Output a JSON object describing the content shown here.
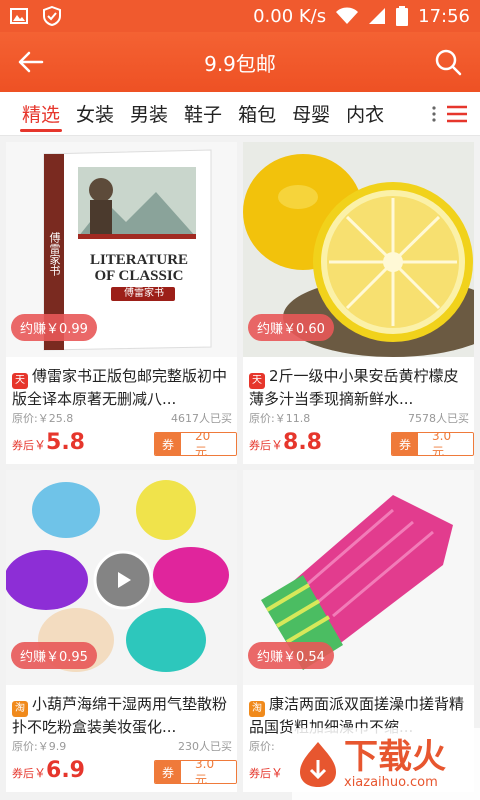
{
  "status": {
    "speed": "0.00 K/s",
    "time": "17:56"
  },
  "appbar": {
    "title": "9.9包邮"
  },
  "tabs": [
    "精选",
    "女装",
    "男装",
    "鞋子",
    "箱包",
    "母婴",
    "内衣"
  ],
  "products": [
    {
      "title": "傅雷家书正版包邮完整版初中版全译本原著无删减八...",
      "earn": "约赚￥0.99",
      "orig": "原价:￥25.8",
      "sold": "4617人已买",
      "after_label": "券后",
      "sym": "￥",
      "price": "5.8",
      "coupon_label": "券",
      "coupon": "20元",
      "source": "tmall",
      "cover": {
        "series": "LITERATURE OF CLASSIC",
        "name": "傅雷家书",
        "spine": "傅雷家书"
      }
    },
    {
      "title": "2斤一级中小果安岳黄柠檬皮薄多汁当季现摘新鲜水...",
      "earn": "约赚￥0.60",
      "orig": "原价:￥11.8",
      "sold": "7578人已买",
      "after_label": "券后",
      "sym": "￥",
      "price": "8.8",
      "coupon_label": "券",
      "coupon": "3.0元",
      "source": "tmall"
    },
    {
      "title": "小葫芦海绵干湿两用气垫散粉扑不吃粉盒装美妆蛋化...",
      "earn": "约赚￥0.95",
      "orig": "原价:￥9.9",
      "sold": "230人已买",
      "after_label": "券后",
      "sym": "￥",
      "price": "6.9",
      "coupon_label": "券",
      "coupon": "3.0元",
      "source": "taobao"
    },
    {
      "title": "康洁两面派双面搓澡巾搓背精品国货粗加细澡巾不缩...",
      "earn": "约赚￥0.54",
      "orig": "原价:",
      "sold": "",
      "after_label": "券后",
      "sym": "￥",
      "price": "",
      "coupon_label": "",
      "coupon": "",
      "source": "taobao"
    }
  ],
  "badges": {
    "tmall": "天",
    "taobao": "淘"
  },
  "watermark": {
    "brand": "下载火",
    "url": "xiazaihuo.com"
  },
  "colors": {
    "header": "#f05a2e",
    "accent": "#e6362c",
    "coupon": "#ef7a3a"
  }
}
